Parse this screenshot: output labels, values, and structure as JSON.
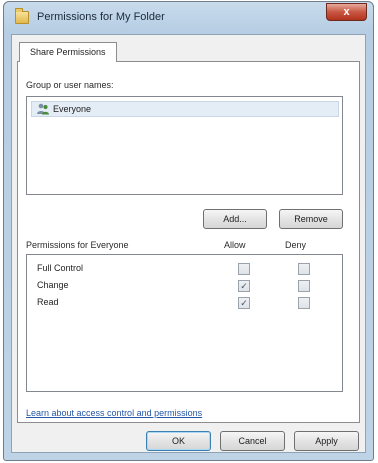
{
  "window": {
    "title": "Permissions for My Folder",
    "close_glyph": "x"
  },
  "tab": {
    "label": "Share Permissions"
  },
  "group": {
    "label": "Group or user names:",
    "items": [
      {
        "name": "Everyone",
        "icon": "users-icon"
      }
    ],
    "add_label": "Add...",
    "remove_label": "Remove"
  },
  "permissions": {
    "label": "Permissions for Everyone",
    "allow_header": "Allow",
    "deny_header": "Deny",
    "rows": [
      {
        "name": "Full Control",
        "allow": false,
        "deny": false
      },
      {
        "name": "Change",
        "allow": true,
        "deny": false
      },
      {
        "name": "Read",
        "allow": true,
        "deny": false
      }
    ]
  },
  "link": {
    "text": "Learn about access control and permissions"
  },
  "footer": {
    "ok_label": "OK",
    "cancel_label": "Cancel",
    "apply_label": "Apply"
  },
  "colors": {
    "accent": "#3c7fb1",
    "link": "#2457a6",
    "close": "#c75743"
  }
}
